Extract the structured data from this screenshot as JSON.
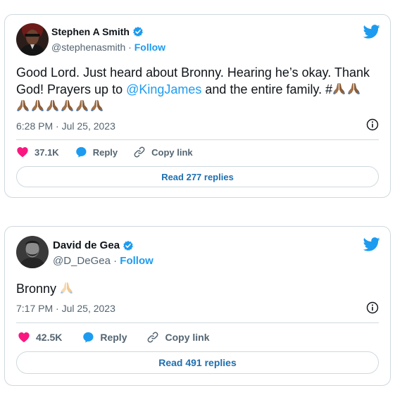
{
  "tweets": [
    {
      "author_name": "Stephen A Smith",
      "handle": "@stephenasmith",
      "separator": "·",
      "follow_label": "Follow",
      "text_before_mention": "Good Lord. Just heard about Bronny. Hearing he’s okay. Thank God! Prayers up to ",
      "mention": "@KingJames",
      "text_after_mention": " and the entire family. #",
      "timestamp": "6:28 PM · Jul 25, 2023",
      "likes": "37.1K",
      "reply_label": "Reply",
      "copy_link_label": "Copy link",
      "read_replies_label": "Read 277 replies"
    },
    {
      "author_name": "David de Gea",
      "handle": "@D_DeGea",
      "separator": "·",
      "follow_label": "Follow",
      "text": "Bronny",
      "timestamp": "7:17 PM · Jul 25, 2023",
      "likes": "42.5K",
      "reply_label": "Reply",
      "copy_link_label": "Copy link",
      "read_replies_label": "Read 491 replies"
    }
  ],
  "icons": {
    "verified": "verified-badge-icon",
    "brand": "twitter-bird-icon",
    "info": "info-icon",
    "like": "heart-icon",
    "reply": "reply-bubble-icon",
    "copy": "link-icon",
    "emoji": "folded-hands-emoji"
  },
  "colors": {
    "accent": "#1d9bf0",
    "like": "#f91880",
    "secondary_text": "#536471",
    "border": "#cfd9de",
    "replies_text": "#1d6fb0"
  }
}
